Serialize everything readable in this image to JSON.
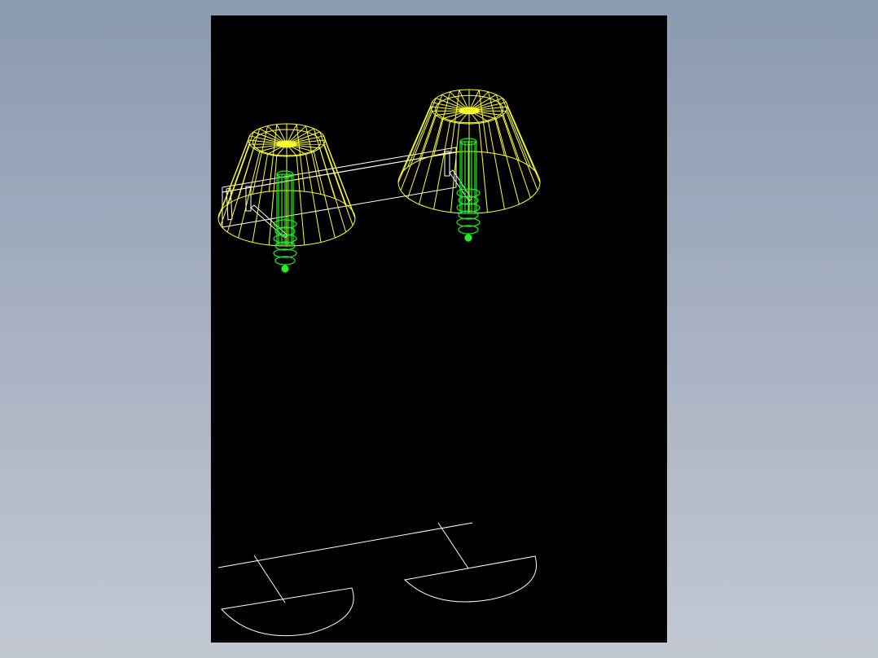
{
  "drawing": {
    "background_color": "#8a9ab0",
    "sheet_color": "#000000",
    "colors": {
      "lamp_shade": "#ffff33",
      "lamp_body": "#22ee22",
      "arm": "#ffffff",
      "plan_lines": "#ffffff"
    },
    "objects": [
      {
        "kind": "lamp",
        "count": 2
      },
      {
        "kind": "wall-bar",
        "count": 1
      },
      {
        "kind": "plan-view",
        "count": 1
      }
    ]
  }
}
